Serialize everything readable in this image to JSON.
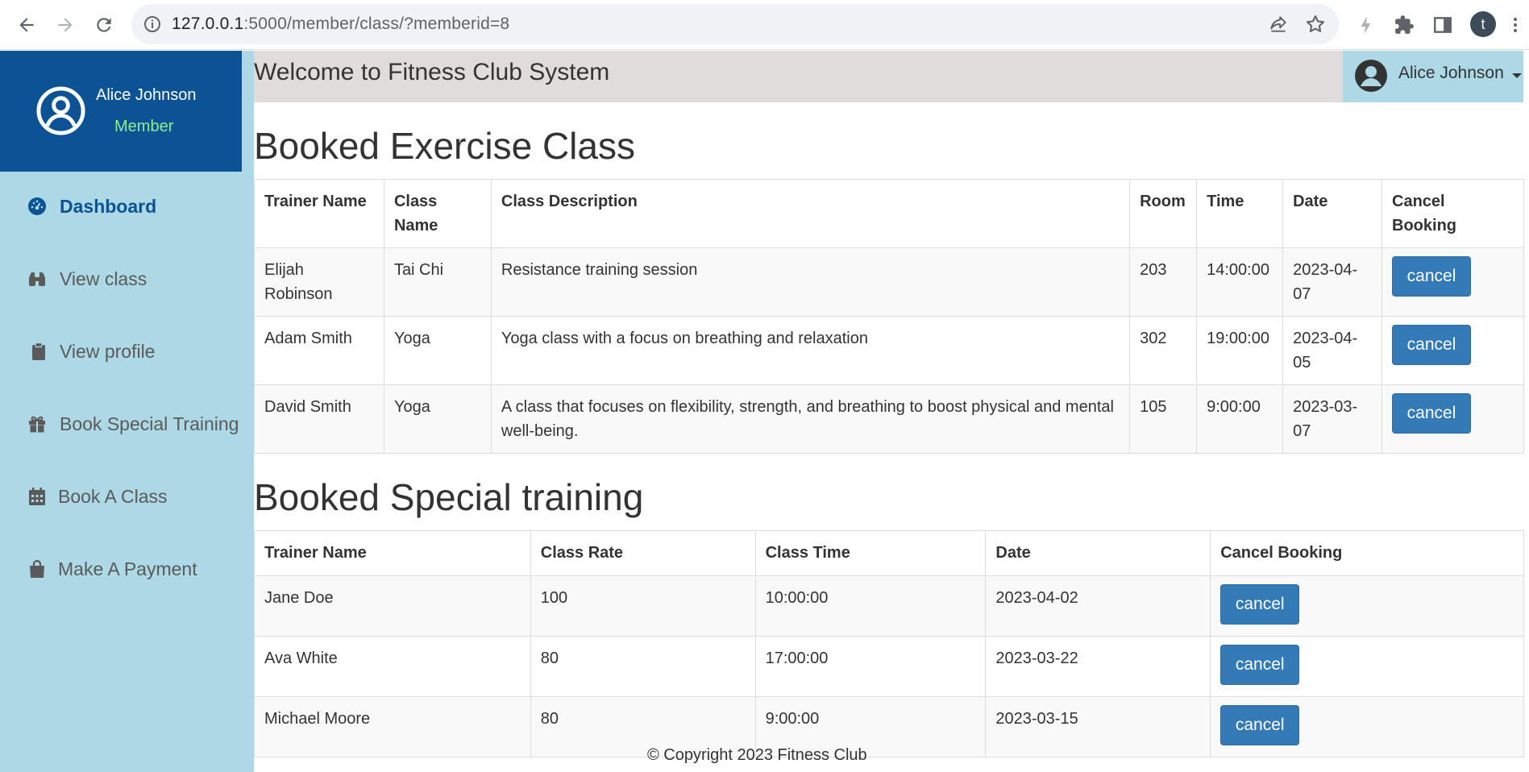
{
  "browser": {
    "url_host": "127.0.0.1",
    "url_rest": ":5000/member/class/?memberid=8",
    "profile_initial": "t"
  },
  "sidebar": {
    "user_name": "Alice Johnson",
    "user_role": "Member",
    "items": [
      {
        "label": "Dashboard",
        "icon": "dashboard-icon"
      },
      {
        "label": "View class",
        "icon": "binoculars-icon"
      },
      {
        "label": "View profile",
        "icon": "clipboard-icon"
      },
      {
        "label": "Book Special Training",
        "icon": "gift-icon"
      },
      {
        "label": "Book A Class",
        "icon": "calendar-icon"
      },
      {
        "label": "Make A Payment",
        "icon": "shopping-bag-icon"
      }
    ]
  },
  "topbar": {
    "welcome": "Welcome to Fitness Club System",
    "user_name": "Alice Johnson"
  },
  "booked_classes": {
    "title": "Booked Exercise Class",
    "headers": [
      "Trainer Name",
      "Class Name",
      "Class Description",
      "Room",
      "Time",
      "Date",
      "Cancel Booking"
    ],
    "rows": [
      {
        "trainer": "Elijah Robinson",
        "class_name": "Tai Chi",
        "description": "Resistance training session",
        "room": "203",
        "time": "14:00:00",
        "date": "2023-04-07",
        "action": "cancel"
      },
      {
        "trainer": "Adam Smith",
        "class_name": "Yoga",
        "description": "Yoga class with a focus on breathing and relaxation",
        "room": "302",
        "time": "19:00:00",
        "date": "2023-04-05",
        "action": "cancel"
      },
      {
        "trainer": "David Smith",
        "class_name": "Yoga",
        "description": "A class that focuses on flexibility, strength, and breathing to boost physical and mental well-being.",
        "room": "105",
        "time": "9:00:00",
        "date": "2023-03-07",
        "action": "cancel"
      }
    ]
  },
  "special_training": {
    "title": "Booked Special training",
    "headers": [
      "Trainer Name",
      "Class Rate",
      "Class Time",
      "Date",
      "Cancel Booking"
    ],
    "rows": [
      {
        "trainer": "Jane Doe",
        "rate": "100",
        "time": "10:00:00",
        "date": "2023-04-02",
        "action": "cancel"
      },
      {
        "trainer": "Ava White",
        "rate": "80",
        "time": "17:00:00",
        "date": "2023-03-22",
        "action": "cancel"
      },
      {
        "trainer": "Michael Moore",
        "rate": "80",
        "time": "9:00:00",
        "date": "2023-03-15",
        "action": "cancel"
      }
    ]
  },
  "footer": {
    "copyright": "© Copyright 2023 Fitness Club"
  },
  "colors": {
    "sidebar_bg": "#add8e6",
    "sidebar_header_bg": "#0b5394",
    "role_text": "#90ee90",
    "topbar_bg": "#e0dcdc",
    "button_primary": "#337ab7"
  }
}
